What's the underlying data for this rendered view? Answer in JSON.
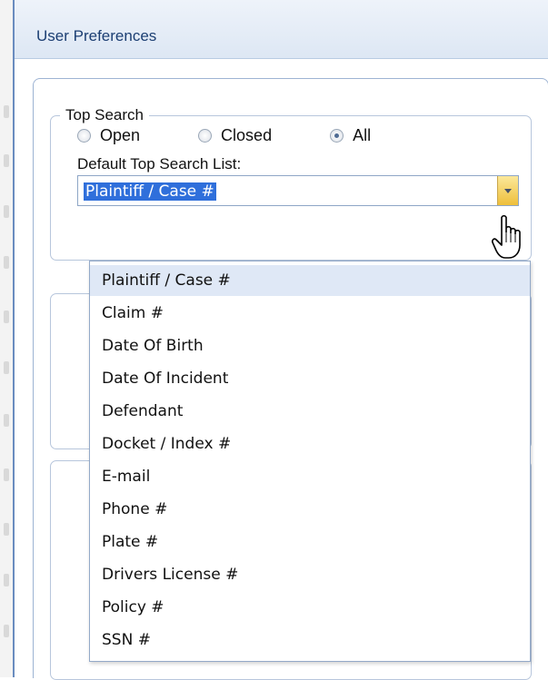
{
  "dialog": {
    "title": "User Preferences"
  },
  "top_search": {
    "legend": "Top Search",
    "radios": [
      {
        "label": "Open",
        "checked": false
      },
      {
        "label": "Closed",
        "checked": false
      },
      {
        "label": "All",
        "checked": true
      }
    ],
    "list_label": "Default Top Search List:",
    "selected_value": "Plaintiff / Case #"
  },
  "dropdown": {
    "items": [
      "Plaintiff / Case #",
      "Claim #",
      "Date Of Birth",
      "Date Of Incident",
      "Defendant",
      "Docket / Index #",
      "E-mail",
      "Phone #",
      "Plate #",
      "Drivers License #",
      "Policy #",
      "SSN #"
    ],
    "highlighted_index": 0
  },
  "icons": {
    "cursor": "hand-pointer-icon",
    "combo_arrow": "chevron-down-icon"
  },
  "colors": {
    "title_text": "#1c3f73",
    "selection": "#2f6fdb",
    "trigger": "#eebf3a"
  }
}
